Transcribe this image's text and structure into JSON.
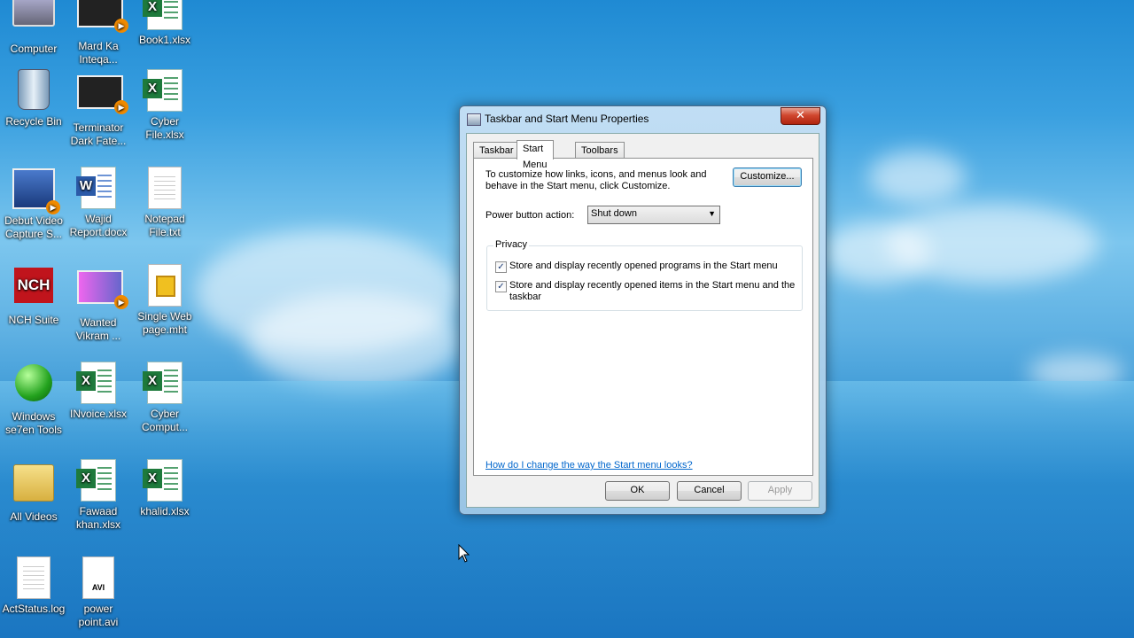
{
  "desktop": {
    "icons": [
      {
        "label": "Computer"
      },
      {
        "label": "Mard Ka Inteqa..."
      },
      {
        "label": "Book1.xlsx"
      },
      {
        "label": "Recycle Bin"
      },
      {
        "label": "Terminator Dark Fate..."
      },
      {
        "label": "Cyber File.xlsx"
      },
      {
        "label": "Debut Video Capture S..."
      },
      {
        "label": "Wajid Report.docx"
      },
      {
        "label": "Notepad File.txt"
      },
      {
        "label": "NCH Suite"
      },
      {
        "label": "Wanted Vikram ..."
      },
      {
        "label": "Single Web page.mht"
      },
      {
        "label": "Windows se7en Tools"
      },
      {
        "label": "INvoice.xlsx"
      },
      {
        "label": "Cyber Comput..."
      },
      {
        "label": "All Videos"
      },
      {
        "label": "Fawaad khan.xlsx"
      },
      {
        "label": "khalid.xlsx"
      },
      {
        "label": "ActStatus.log"
      },
      {
        "label": "power point.avi"
      }
    ]
  },
  "dialog": {
    "title": "Taskbar and Start Menu Properties",
    "close_glyph": "✕",
    "tabs": [
      {
        "label": "Taskbar"
      },
      {
        "label": "Start Menu"
      },
      {
        "label": "Toolbars"
      }
    ],
    "description": "To customize how links, icons, and menus look and behave in the Start menu, click Customize.",
    "customize_label": "Customize...",
    "power_label": "Power button action:",
    "power_value": "Shut down",
    "privacy": {
      "title": "Privacy",
      "opt1": "Store and display recently opened programs in the Start menu",
      "opt2": "Store and display recently opened items in the Start menu and the taskbar"
    },
    "help_link": "How do I change the way the Start menu looks?",
    "ok_label": "OK",
    "cancel_label": "Cancel",
    "apply_label": "Apply"
  }
}
